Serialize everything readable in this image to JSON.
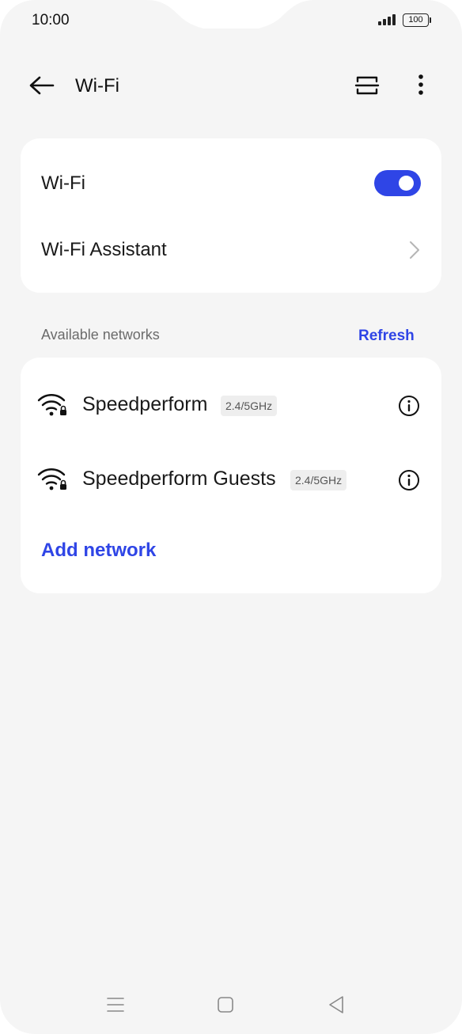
{
  "status_bar": {
    "time": "10:00",
    "battery_level": "100",
    "icons": [
      "signal-icon",
      "battery-icon"
    ]
  },
  "header": {
    "title": "Wi-Fi",
    "icons": [
      "back-arrow-icon",
      "qr-scan-icon",
      "more-vert-icon"
    ]
  },
  "settings": {
    "wifi_label": "Wi-Fi",
    "wifi_enabled": true,
    "assistant_label": "Wi-Fi Assistant"
  },
  "networks_section": {
    "label": "Available networks",
    "refresh_label": "Refresh",
    "networks": [
      {
        "name": "Speedperform",
        "band": "2.4/5GHz",
        "secured": true
      },
      {
        "name": "Speedperform Guests",
        "band": "2.4/5GHz",
        "secured": true
      }
    ],
    "add_network_label": "Add network"
  },
  "nav_bar": {
    "icons": [
      "menu-icon",
      "home-icon",
      "back-triangle-icon"
    ]
  },
  "colors": {
    "accent": "#2f45e6",
    "background": "#f5f5f5",
    "card": "#ffffff",
    "secondary_text": "#6b6b6b"
  }
}
